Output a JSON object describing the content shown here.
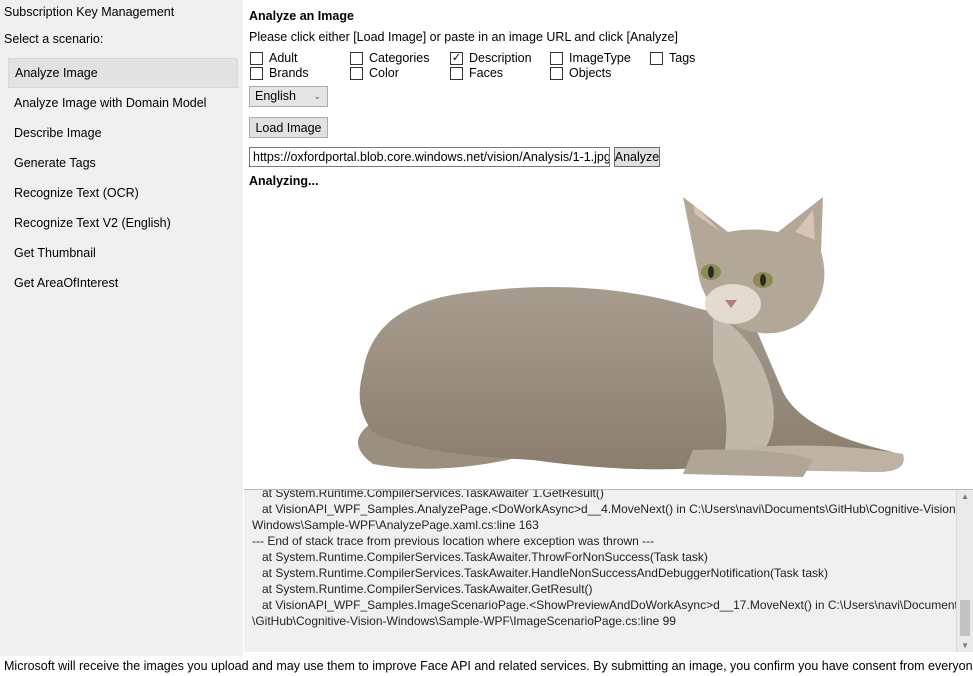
{
  "sidebar": {
    "key_link": "Subscription Key Management",
    "select_label": "Select a scenario:",
    "items": [
      {
        "label": "Analyze Image",
        "selected": true
      },
      {
        "label": "Analyze Image with Domain Model",
        "selected": false
      },
      {
        "label": "Describe Image",
        "selected": false
      },
      {
        "label": "Generate Tags",
        "selected": false
      },
      {
        "label": "Recognize Text (OCR)",
        "selected": false
      },
      {
        "label": "Recognize Text V2 (English)",
        "selected": false
      },
      {
        "label": "Get Thumbnail",
        "selected": false
      },
      {
        "label": "Get AreaOfInterest",
        "selected": false
      }
    ]
  },
  "main": {
    "title": "Analyze an Image",
    "instructions": "Please click either [Load Image] or paste in an image URL and click [Analyze]",
    "features": [
      {
        "label": "Adult",
        "checked": false
      },
      {
        "label": "Brands",
        "checked": false
      },
      {
        "label": "Categories",
        "checked": false
      },
      {
        "label": "Color",
        "checked": false
      },
      {
        "label": "Description",
        "checked": true
      },
      {
        "label": "Faces",
        "checked": false
      },
      {
        "label": "ImageType",
        "checked": false
      },
      {
        "label": "Objects",
        "checked": false
      },
      {
        "label": "Tags",
        "checked": false
      }
    ],
    "language": "English",
    "load_button": "Load Image",
    "url_value": "https://oxfordportal.blob.core.windows.net/vision/Analysis/1-1.jpg",
    "analyze_button": "Analyze",
    "status": "Analyzing..."
  },
  "log": {
    "lines": [
      "   at System.Runtime.CompilerServices.TaskAwaiter`1.GetResult()",
      "   at VisionAPI_WPF_Samples.AnalyzePage.<DoWorkAsync>d__4.MoveNext() in C:\\Users\\navi\\Documents\\GitHub\\Cognitive-Vision-",
      "Windows\\Sample-WPF\\AnalyzePage.xaml.cs:line 163",
      "--- End of stack trace from previous location where exception was thrown ---",
      "   at System.Runtime.CompilerServices.TaskAwaiter.ThrowForNonSuccess(Task task)",
      "   at System.Runtime.CompilerServices.TaskAwaiter.HandleNonSuccessAndDebuggerNotification(Task task)",
      "   at System.Runtime.CompilerServices.TaskAwaiter.GetResult()",
      "   at VisionAPI_WPF_Samples.ImageScenarioPage.<ShowPreviewAndDoWorkAsync>d__17.MoveNext() in C:\\Users\\navi\\Documents",
      "\\GitHub\\Cognitive-Vision-Windows\\Sample-WPF\\ImageScenarioPage.cs:line 99"
    ]
  },
  "footer": "Microsoft will receive the images you upload and may use them to improve Face API and related services. By submitting an image, you confirm you have consent from everyone in it."
}
